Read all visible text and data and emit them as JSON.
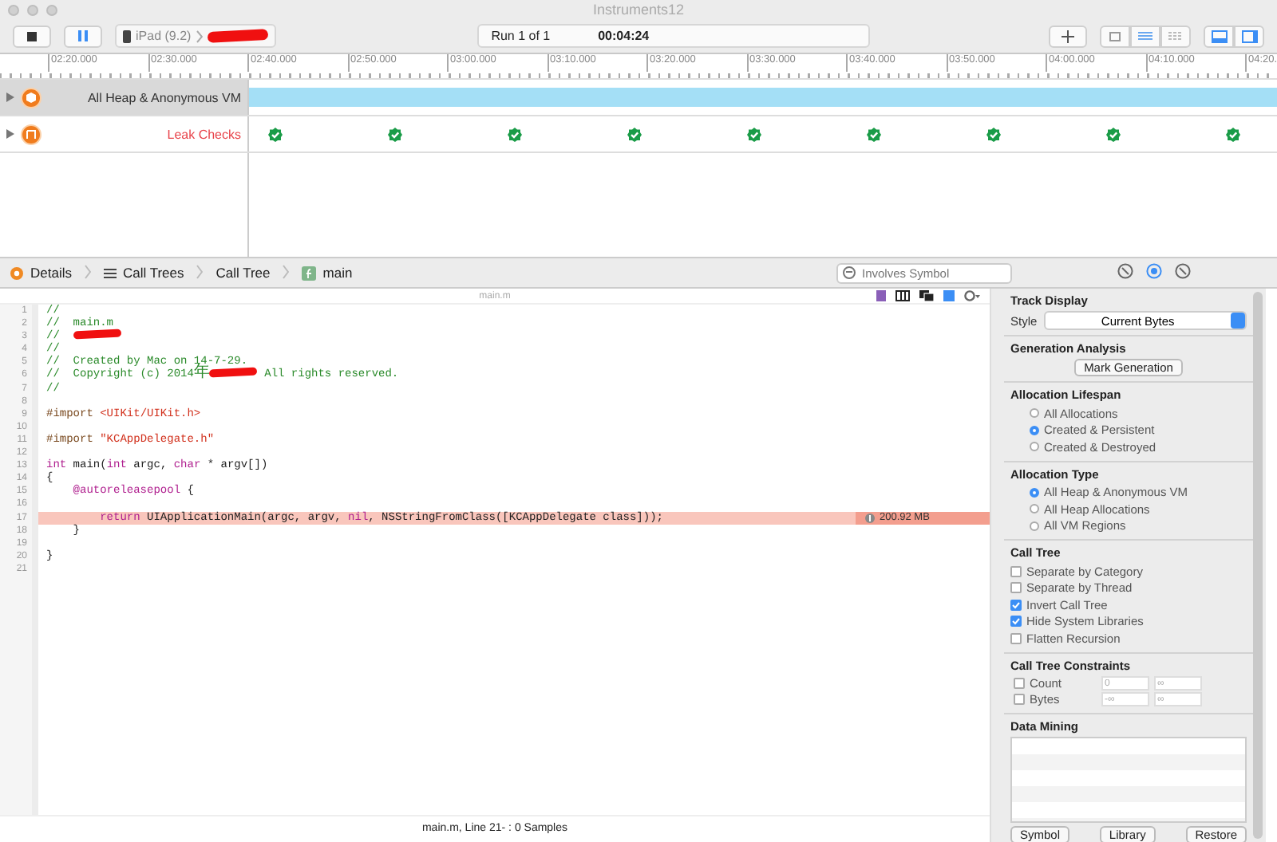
{
  "window": {
    "title": "Instruments12"
  },
  "toolbar": {
    "device": "iPad (9.2)",
    "run": "Run 1 of 1",
    "time": "00:04:24",
    "view_buttons": [
      {
        "selected": true
      },
      {
        "selected": true
      }
    ]
  },
  "ruler": [
    "02:20.000",
    "02:30.000",
    "02:40.000",
    "02:50.000",
    "03:00.000",
    "03:10.000",
    "03:20.000",
    "03:30.000",
    "03:40.000",
    "03:50.000",
    "04:00.000",
    "04:10.000",
    "04:20."
  ],
  "tracks": [
    {
      "name": "All Heap & Anonymous VM",
      "selected": true,
      "color": "#333333",
      "kind": "band"
    },
    {
      "name": "Leak Checks",
      "selected": false,
      "color": "#e8434a",
      "kind": "checks"
    }
  ],
  "breadcrumbs": [
    {
      "label": "Details",
      "kind": "details"
    },
    {
      "label": "Call Trees",
      "kind": "list"
    },
    {
      "label": "Call Tree",
      "kind": "plain"
    },
    {
      "label": "main",
      "kind": "function"
    }
  ],
  "search": {
    "placeholder": "Involves Symbol"
  },
  "inspector_tabs": [
    {
      "selected": false
    },
    {
      "selected": true
    },
    {
      "selected": false
    }
  ],
  "editor": {
    "file": "main.m",
    "lines": [
      {
        "number": "1",
        "highlighted": false,
        "tokens": [
          {
            "kind": "comment",
            "text": "//"
          }
        ]
      },
      {
        "number": "2",
        "highlighted": false,
        "tokens": [
          {
            "kind": "comment",
            "text": "//  main.m"
          }
        ]
      },
      {
        "number": "3",
        "highlighted": false,
        "tokens": [
          {
            "kind": "comment",
            "text": "//  "
          },
          {
            "kind": "redacted"
          }
        ]
      },
      {
        "number": "4",
        "highlighted": false,
        "tokens": [
          {
            "kind": "comment",
            "text": "//"
          }
        ]
      },
      {
        "number": "5",
        "highlighted": false,
        "tokens": [
          {
            "kind": "comment",
            "text": "//  Created by Mac on 14-7-29."
          }
        ]
      },
      {
        "number": "6",
        "highlighted": false,
        "tokens": [
          {
            "kind": "comment",
            "text": "//  Copyright (c) 2014"
          },
          {
            "kind": "cjk",
            "text": "年"
          },
          {
            "kind": "redacted"
          },
          {
            "kind": "comment",
            "text": " All rights reserved."
          }
        ]
      },
      {
        "number": "7",
        "highlighted": false,
        "tokens": [
          {
            "kind": "comment",
            "text": "//"
          }
        ]
      },
      {
        "number": "8",
        "highlighted": false
      },
      {
        "number": "9",
        "highlighted": false,
        "tokens": [
          {
            "kind": "directive",
            "text": "#import "
          },
          {
            "kind": "string",
            "text": "<UIKit/UIKit.h>"
          }
        ]
      },
      {
        "number": "10",
        "highlighted": false
      },
      {
        "number": "11",
        "highlighted": false,
        "tokens": [
          {
            "kind": "directive",
            "text": "#import "
          },
          {
            "kind": "string",
            "text": "\"KCAppDelegate.h\""
          }
        ]
      },
      {
        "number": "12",
        "highlighted": false
      },
      {
        "number": "13",
        "highlighted": false,
        "tokens": [
          {
            "kind": "keyword",
            "text": "int"
          },
          {
            "kind": "plain",
            "text": " main("
          },
          {
            "kind": "keyword",
            "text": "int"
          },
          {
            "kind": "plain",
            "text": " argc, "
          },
          {
            "kind": "keyword",
            "text": "char"
          },
          {
            "kind": "plain",
            "text": " * argv[])"
          }
        ]
      },
      {
        "number": "14",
        "highlighted": false,
        "tokens": [
          {
            "kind": "plain",
            "text": "{"
          }
        ]
      },
      {
        "number": "15",
        "highlighted": false,
        "tokens": [
          {
            "kind": "keyword",
            "text": "    @autoreleasepool"
          },
          {
            "kind": "plain",
            "text": " {"
          }
        ]
      },
      {
        "number": "16",
        "highlighted": false
      },
      {
        "number": "17",
        "highlighted": true,
        "badge": "200.92 MB",
        "tokens": [
          {
            "kind": "keyword",
            "text": "        return"
          },
          {
            "kind": "plain",
            "text": " UIApplicationMain(argc, argv, "
          },
          {
            "kind": "keyword",
            "text": "nil"
          },
          {
            "kind": "plain",
            "text": ", NSStringFromClass([KCAppDelegate class]));"
          }
        ]
      },
      {
        "number": "18",
        "highlighted": false,
        "tokens": [
          {
            "kind": "plain",
            "text": "    }"
          }
        ]
      },
      {
        "number": "19",
        "highlighted": false
      },
      {
        "number": "20",
        "highlighted": false,
        "tokens": [
          {
            "kind": "plain",
            "text": "}"
          }
        ]
      },
      {
        "number": "21",
        "highlighted": false
      }
    ]
  },
  "status_bar": "main.m, Line 21- : 0 Samples",
  "inspector": [
    {
      "kind": "select",
      "title": "Track Display",
      "label": "Style",
      "value": "Current Bytes"
    },
    {
      "kind": "button",
      "title": "Generation Analysis",
      "button": "Mark Generation"
    },
    {
      "kind": "radio",
      "title": "Allocation Lifespan",
      "options": [
        {
          "label": "All Allocations",
          "selected": false
        },
        {
          "label": "Created & Persistent",
          "selected": true
        },
        {
          "label": "Created & Destroyed",
          "selected": false
        }
      ]
    },
    {
      "kind": "radio",
      "title": "Allocation Type",
      "options": [
        {
          "label": "All Heap & Anonymous VM",
          "selected": true
        },
        {
          "label": "All Heap Allocations",
          "selected": false
        },
        {
          "label": "All VM Regions",
          "selected": false
        }
      ]
    },
    {
      "kind": "checkbox",
      "title": "Call Tree",
      "options": [
        {
          "label": "Separate by Category",
          "checked": false
        },
        {
          "label": "Separate by Thread",
          "checked": false
        },
        {
          "label": "Invert Call Tree",
          "checked": true
        },
        {
          "label": "Hide System Libraries",
          "checked": true
        },
        {
          "label": "Flatten Recursion",
          "checked": false
        }
      ]
    },
    {
      "kind": "constraints",
      "title": "Call Tree Constraints",
      "rows": [
        {
          "label": "Count",
          "checked": false,
          "min": {
            "placeholder": "0"
          },
          "max": {
            "placeholder": "∞"
          }
        },
        {
          "label": "Bytes",
          "checked": false,
          "min": {
            "placeholder": "-∞"
          },
          "max": {
            "placeholder": "∞"
          }
        }
      ]
    },
    {
      "kind": "mining",
      "title": "Data Mining",
      "buttons": [
        "Symbol",
        "Library",
        "Restore"
      ]
    }
  ]
}
